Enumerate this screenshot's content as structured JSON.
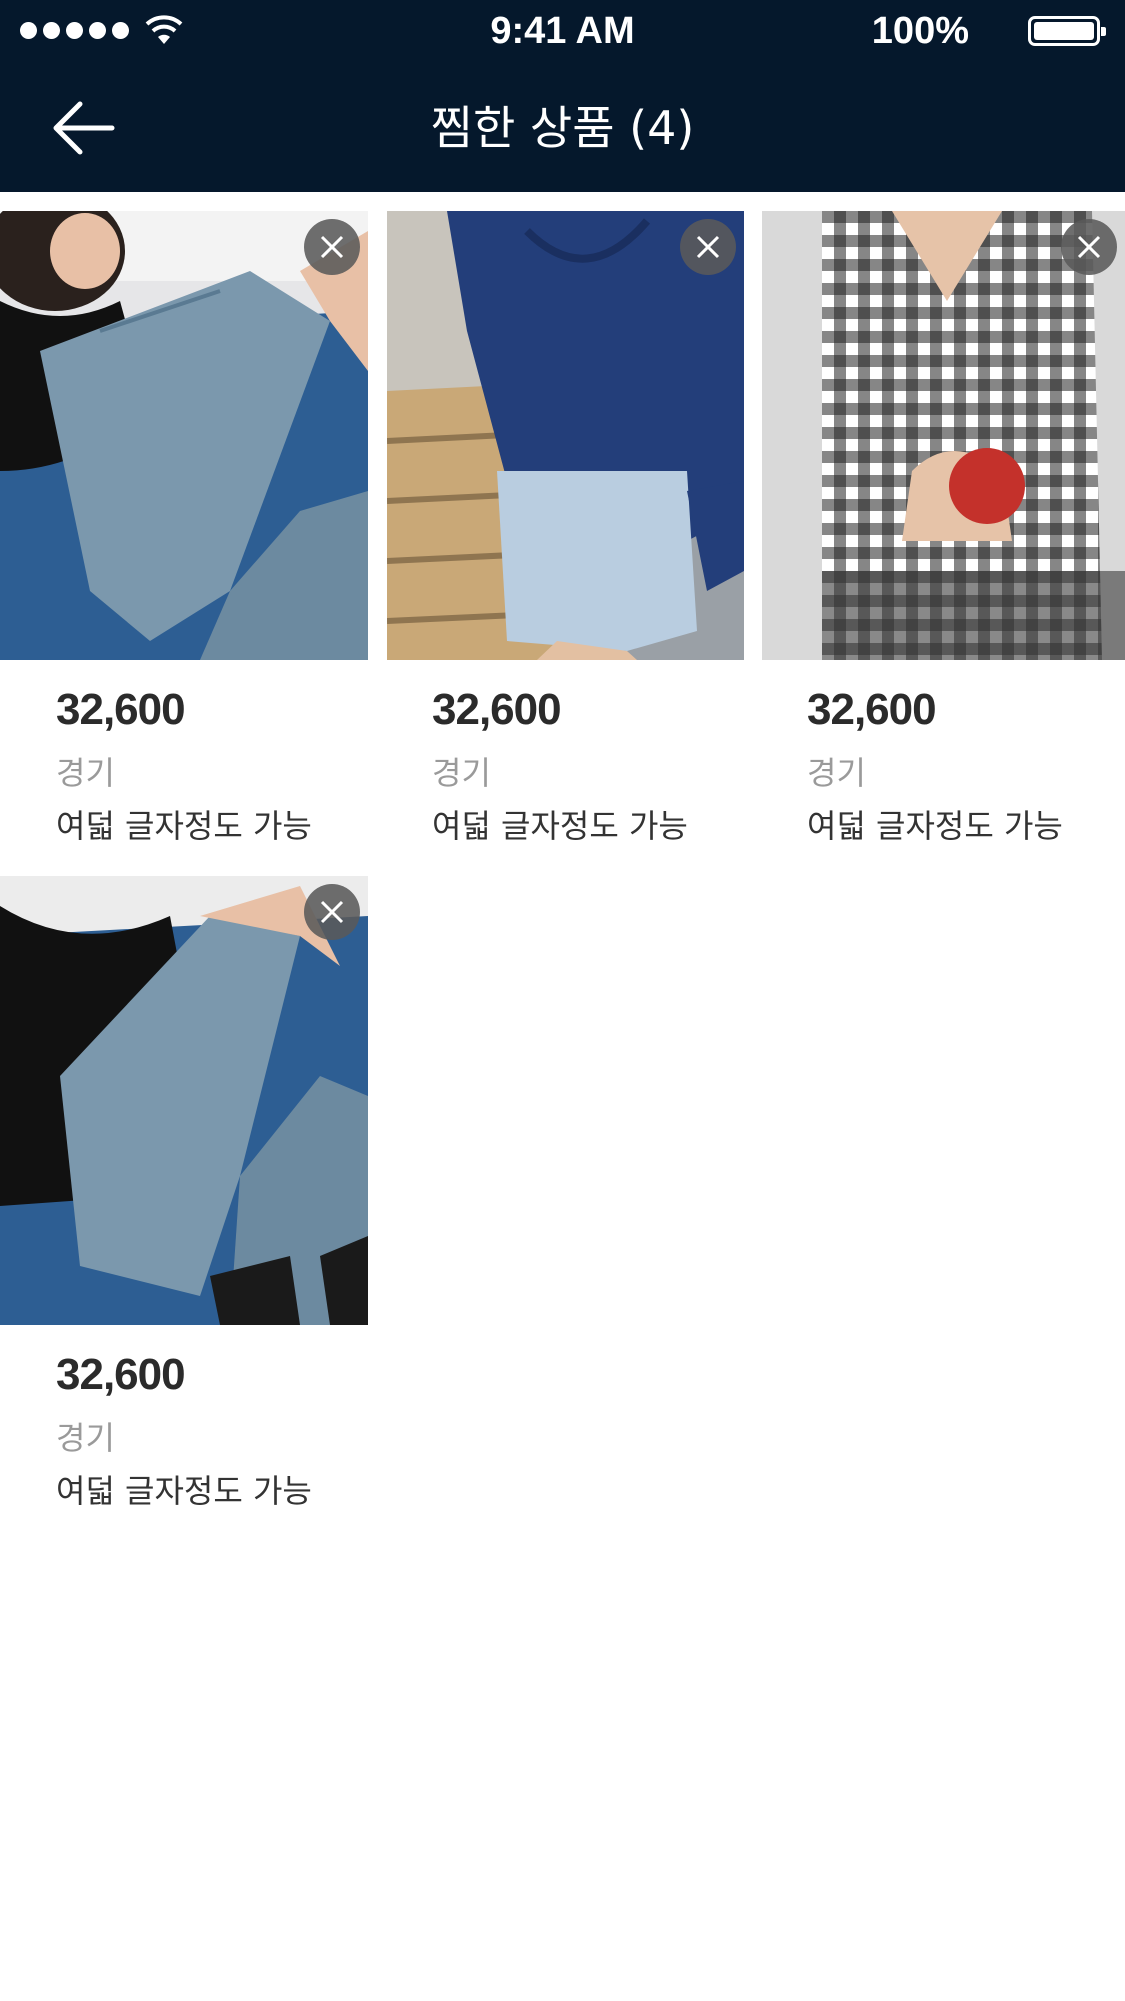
{
  "status_bar": {
    "time": "9:41 AM",
    "battery": "100%",
    "signal_icon": "signal-dots-icon",
    "wifi_icon": "wifi-icon",
    "battery_icon": "battery-icon"
  },
  "header": {
    "title": "찜한 상품 (4)",
    "back_icon": "back-arrow-icon",
    "background": "#05182c"
  },
  "products": [
    {
      "price": "32,600",
      "region": "경기",
      "description": "여덟 글자정도 가능",
      "image": "model in black top and light-wash jeans on blue sofa",
      "remove_icon": "close-icon"
    },
    {
      "price": "32,600",
      "region": "경기",
      "description": "여덟 글자정도 가능",
      "image": "blue linen shirt with denim shorts on wooden deck",
      "remove_icon": "close-icon"
    },
    {
      "price": "32,600",
      "region": "경기",
      "description": "여덟 글자정도 가능",
      "image": "black and white gingham pajama set holding a red apple",
      "remove_icon": "close-icon"
    },
    {
      "price": "32,600",
      "region": "경기",
      "description": "여덟 글자정도 가능",
      "image": "model in black top and light-wash jeans on blue sofa",
      "remove_icon": "close-icon"
    }
  ]
}
